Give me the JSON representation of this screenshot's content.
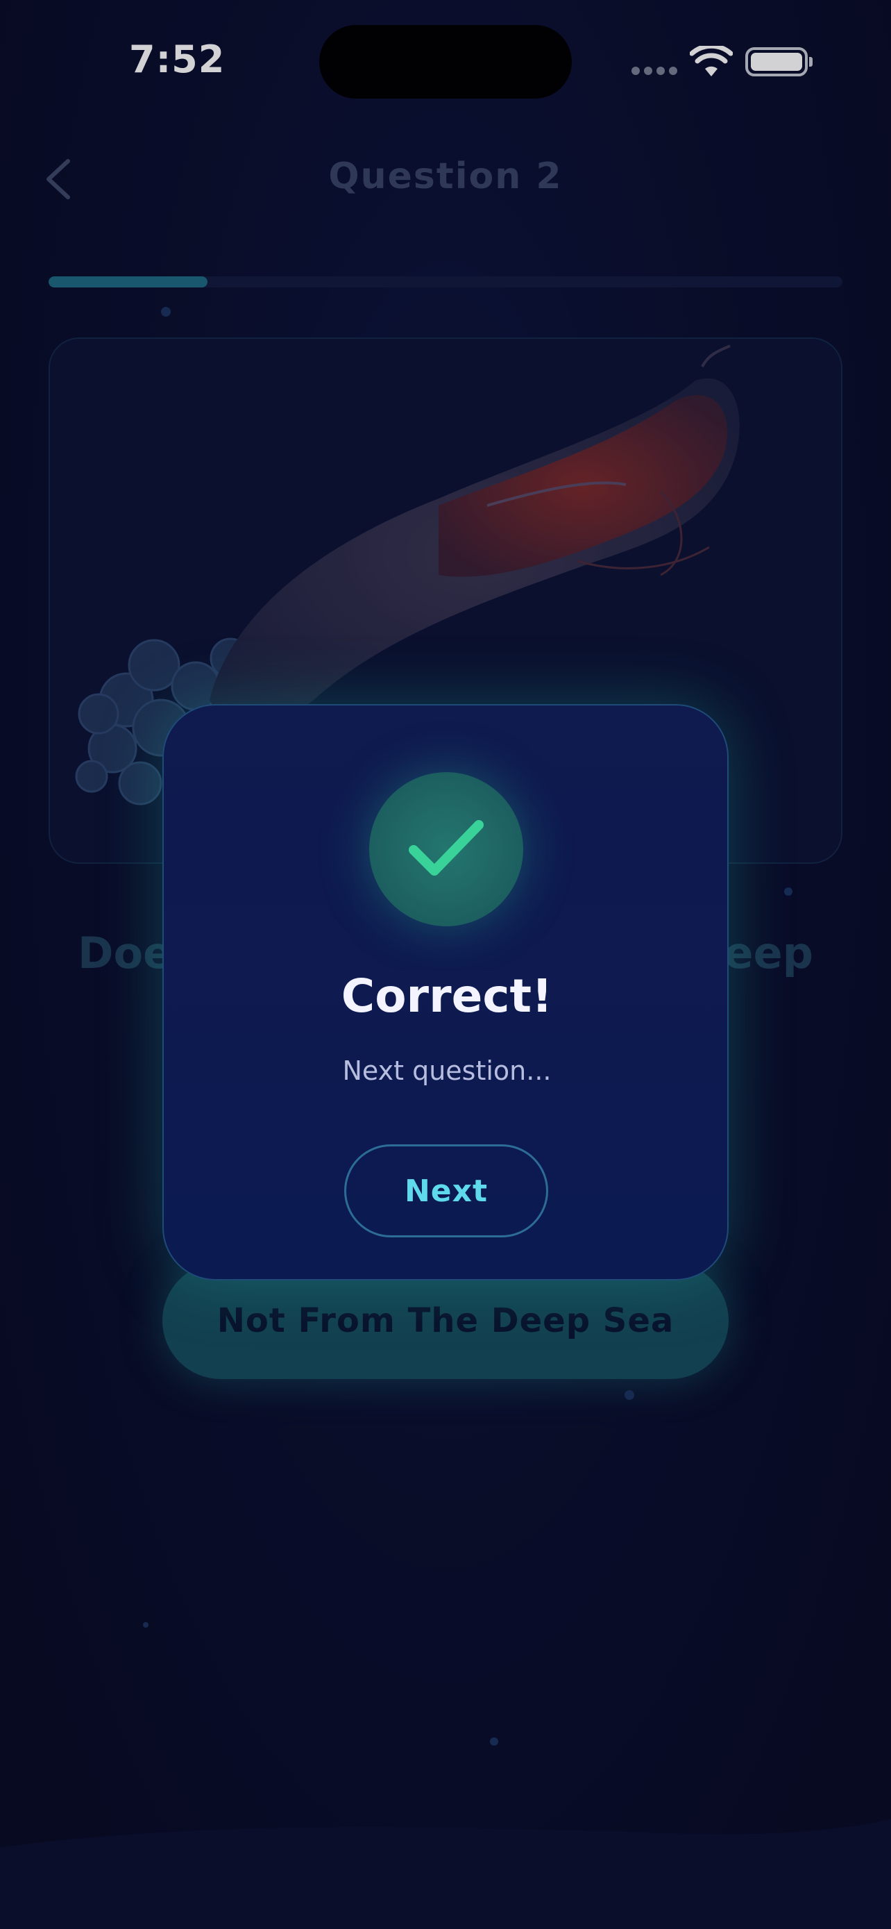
{
  "status_bar": {
    "time": "7:52",
    "icons": [
      "signal-icon",
      "wifi-icon",
      "battery-icon"
    ]
  },
  "header": {
    "back_icon": "chevron-left-icon",
    "title": "Question 2"
  },
  "progress": {
    "fraction": 0.2,
    "fill_color": "#1d6a80"
  },
  "question": {
    "left_fragment": "Doe",
    "right_fragment": "leep"
  },
  "answer": {
    "label": "Not From The Deep Sea"
  },
  "modal": {
    "icon": "checkmark-icon",
    "title": "Correct!",
    "subtitle": "Next question...",
    "next_label": "Next",
    "accent_color": "#39d39a"
  }
}
